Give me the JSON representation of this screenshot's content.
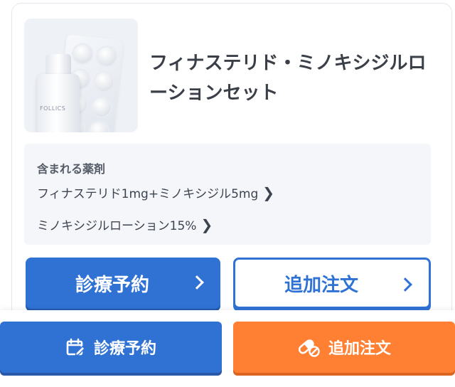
{
  "product": {
    "title": "フィナステリド・ミノキシジルローションセット",
    "image_alt": "product-set-image",
    "bottle_brand": "FOLLICS"
  },
  "drugs": {
    "heading": "含まれる薬剤",
    "items": [
      {
        "label": "フィナステリド1mg+ミノキシジル5mg"
      },
      {
        "label": "ミノキシジルローション15%"
      }
    ],
    "chevron": "❯"
  },
  "card_actions": {
    "reserve_label": "診療予約",
    "reorder_label": "追加注文"
  },
  "bottom_bar": {
    "reserve_label": "診療予約",
    "reorder_label": "追加注文",
    "reserve_icon": "calendar-edit-icon",
    "reorder_icon": "pill-cancel-icon"
  },
  "colors": {
    "primary_blue": "#2f72d4",
    "accent_orange": "#ff7f33",
    "box_bg": "#f4f6fa"
  }
}
